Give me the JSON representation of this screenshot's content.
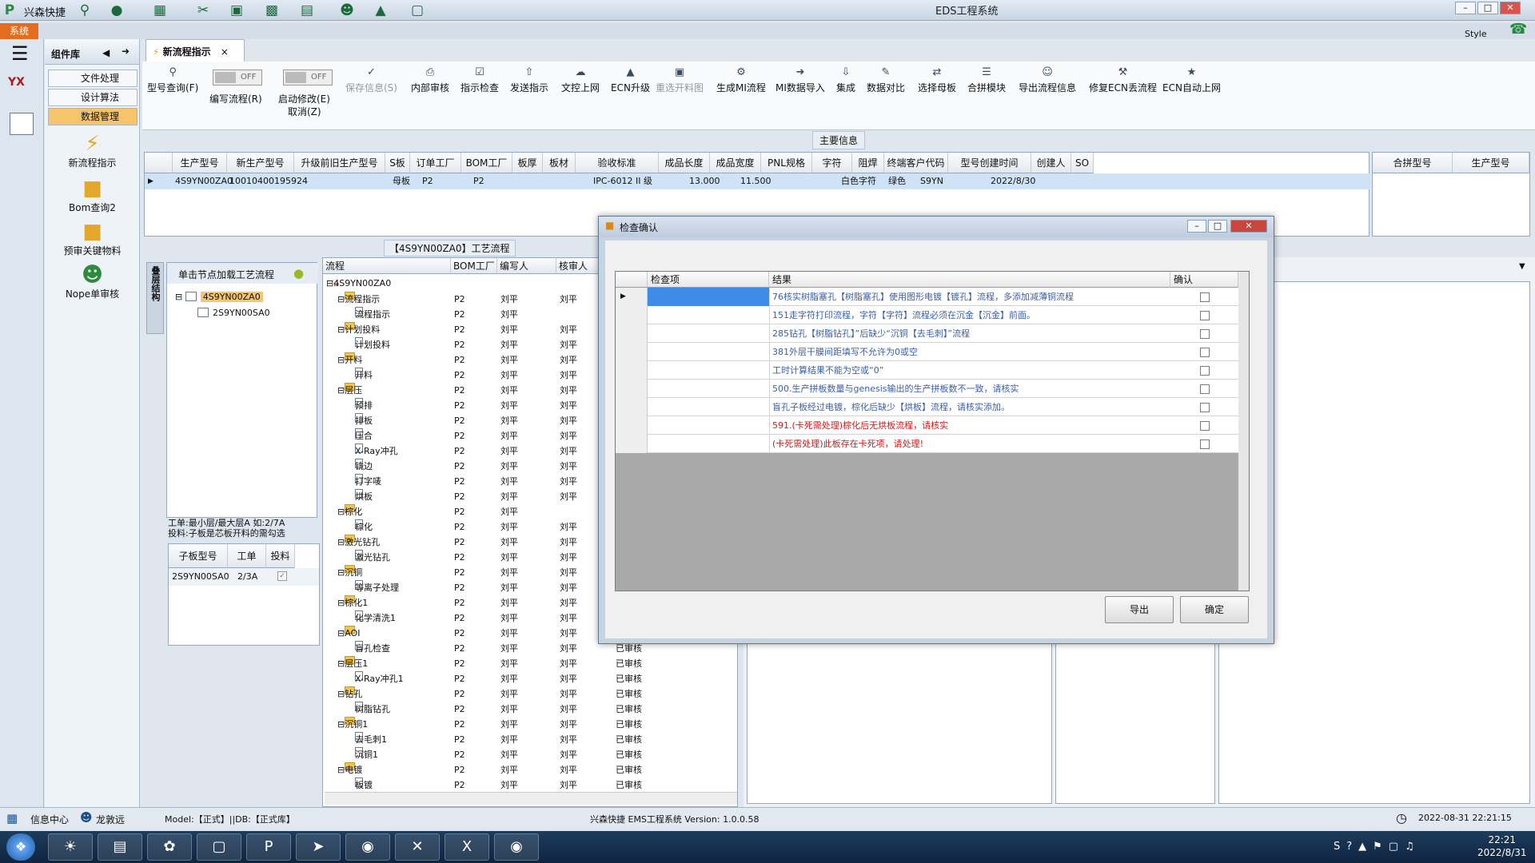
{
  "app": {
    "name": "兴森快捷",
    "window_title": "EDS工程系统",
    "style_label": "Style",
    "system_tab": "系统"
  },
  "component_panel": {
    "title": "组件库",
    "items": [
      "文件处理",
      "设计算法",
      "数据管理"
    ],
    "tools": [
      "新流程指示",
      "Bom查询2",
      "预审关键物料",
      "Nope单审核"
    ]
  },
  "doc_tab": {
    "label": "新流程指示",
    "close": "×"
  },
  "ribbon": {
    "type_query": "型号查询(F)",
    "write_flow": "编写流程(R)",
    "start_modify": "启动修改(E)",
    "cancel": "取消(Z)",
    "toggle_off": "OFF",
    "buttons": [
      "保存信息(S)",
      "内部审核",
      "指示检查",
      "发送指示",
      "文控上网",
      "ECN升级",
      "重选开料图",
      "生成MI流程",
      "MI数据导入",
      "集成",
      "数据对比",
      "选择母板",
      "合拼模块",
      "导出流程信息",
      "修复ECN丢流程",
      "ECN自动上网"
    ]
  },
  "main_info": {
    "label": "主要信息",
    "headers": [
      "生产型号",
      "新生产型号",
      "升级前旧生产型号",
      "S板",
      "订单工厂",
      "BOM工厂",
      "板厚",
      "板材",
      "验收标准",
      "成品长度",
      "成品宽度",
      "PNL规格",
      "字符",
      "阻焊",
      "终端客户代码",
      "型号创建时间",
      "创建人",
      "SO"
    ],
    "row": {
      "c0": "4S9YN00ZA0",
      "c1": "10010400195924",
      "c2": "",
      "c3": "母板",
      "c4": "P2",
      "c5": "P2",
      "c6": "",
      "c7": "",
      "c8": "IPC-6012 II 级",
      "c9": "13.000",
      "c10": "11.500",
      "c11": "",
      "c12": "白色字符",
      "c13": "绿色",
      "c14": "S9YN",
      "c15": "2022/8/30",
      "c16": "",
      "c17": ""
    },
    "merge_headers": [
      "合拼型号",
      "生产型号"
    ]
  },
  "process": {
    "title": "【4S9YN00ZA0】工艺流程",
    "side_tab": "叠层结构",
    "load_hint": "单击节点加载工艺流程",
    "tree_nodes": [
      "4S9YN00ZA0",
      "2S9YN00SA0"
    ],
    "note": "工单:最小层/最大层A 如:2/7A\n投料:子板是芯板开料的需勾选",
    "sub_headers": [
      "子板型号",
      "工单",
      "投料"
    ],
    "sub_row": {
      "model": "2S9YN00SA0",
      "order": "2/3A"
    },
    "tree_headers": [
      "流程",
      "BOM工厂",
      "编写人",
      "核审人"
    ],
    "root": "4S9YN00ZA0",
    "rows": [
      {
        "name": "流程指示",
        "type": "folder",
        "bom": "P2",
        "writer": "刘平",
        "reviewer": "刘平",
        "status": ""
      },
      {
        "name": "流程指示",
        "type": "file",
        "bom": "P2",
        "writer": "刘平",
        "reviewer": "",
        "status": ""
      },
      {
        "name": "计划投料",
        "type": "folder",
        "bom": "P2",
        "writer": "刘平",
        "reviewer": "刘平",
        "status": ""
      },
      {
        "name": "计划投料",
        "type": "file",
        "bom": "P2",
        "writer": "刘平",
        "reviewer": "刘平",
        "status": ""
      },
      {
        "name": "开料",
        "type": "folder",
        "bom": "P2",
        "writer": "刘平",
        "reviewer": "刘平",
        "status": ""
      },
      {
        "name": "开料",
        "type": "file",
        "bom": "P2",
        "writer": "刘平",
        "reviewer": "刘平",
        "status": ""
      },
      {
        "name": "层压",
        "type": "folder",
        "bom": "P2",
        "writer": "刘平",
        "reviewer": "刘平",
        "status": ""
      },
      {
        "name": "预排",
        "type": "file",
        "bom": "P2",
        "writer": "刘平",
        "reviewer": "刘平",
        "status": ""
      },
      {
        "name": "排板",
        "type": "file",
        "bom": "P2",
        "writer": "刘平",
        "reviewer": "刘平",
        "status": ""
      },
      {
        "name": "压合",
        "type": "file",
        "bom": "P2",
        "writer": "刘平",
        "reviewer": "刘平",
        "status": ""
      },
      {
        "name": "X-Ray冲孔",
        "type": "file",
        "bom": "P2",
        "writer": "刘平",
        "reviewer": "刘平",
        "status": ""
      },
      {
        "name": "铣边",
        "type": "file",
        "bom": "P2",
        "writer": "刘平",
        "reviewer": "刘平",
        "status": ""
      },
      {
        "name": "打字唛",
        "type": "file",
        "bom": "P2",
        "writer": "刘平",
        "reviewer": "刘平",
        "status": ""
      },
      {
        "name": "烘板",
        "type": "file",
        "bom": "P2",
        "writer": "刘平",
        "reviewer": "刘平",
        "status": ""
      },
      {
        "name": "棕化",
        "type": "folder",
        "bom": "P2",
        "writer": "刘平",
        "reviewer": "",
        "status": ""
      },
      {
        "name": "棕化",
        "type": "file",
        "bom": "P2",
        "writer": "刘平",
        "reviewer": "刘平",
        "status": ""
      },
      {
        "name": "激光钻孔",
        "type": "folder",
        "bom": "P2",
        "writer": "刘平",
        "reviewer": "刘平",
        "status": ""
      },
      {
        "name": "激光钻孔",
        "type": "file",
        "bom": "P2",
        "writer": "刘平",
        "reviewer": "刘平",
        "status": ""
      },
      {
        "name": "沉铜",
        "type": "folder",
        "bom": "P2",
        "writer": "刘平",
        "reviewer": "刘平",
        "status": ""
      },
      {
        "name": "等离子处理",
        "type": "file",
        "bom": "P2",
        "writer": "刘平",
        "reviewer": "刘平",
        "status": ""
      },
      {
        "name": "棕化1",
        "type": "folder",
        "bom": "P2",
        "writer": "刘平",
        "reviewer": "刘平",
        "status": ""
      },
      {
        "name": "化学清洗1",
        "type": "file",
        "bom": "P2",
        "writer": "刘平",
        "reviewer": "刘平",
        "status": ""
      },
      {
        "name": "AOI",
        "type": "folder",
        "bom": "P2",
        "writer": "刘平",
        "reviewer": "刘平",
        "status": ""
      },
      {
        "name": "盲孔检查",
        "type": "file",
        "bom": "P2",
        "writer": "刘平",
        "reviewer": "刘平",
        "status": "已审核"
      },
      {
        "name": "层压1",
        "type": "folder",
        "bom": "P2",
        "writer": "刘平",
        "reviewer": "刘平",
        "status": "已审核"
      },
      {
        "name": "X-Ray冲孔1",
        "type": "file",
        "bom": "P2",
        "writer": "刘平",
        "reviewer": "刘平",
        "status": "已审核"
      },
      {
        "name": "钻孔",
        "type": "folder",
        "bom": "P2",
        "writer": "刘平",
        "reviewer": "刘平",
        "status": "已审核"
      },
      {
        "name": "树脂钻孔",
        "type": "file",
        "bom": "P2",
        "writer": "刘平",
        "reviewer": "刘平",
        "status": "已审核"
      },
      {
        "name": "沉铜1",
        "type": "folder",
        "bom": "P2",
        "writer": "刘平",
        "reviewer": "刘平",
        "status": "已审核"
      },
      {
        "name": "去毛刺1",
        "type": "file",
        "bom": "P2",
        "writer": "刘平",
        "reviewer": "刘平",
        "status": "已审核"
      },
      {
        "name": "沉铜1",
        "type": "file",
        "bom": "P2",
        "writer": "刘平",
        "reviewer": "刘平",
        "status": "已审核"
      },
      {
        "name": "电镀",
        "type": "folder",
        "bom": "P2",
        "writer": "刘平",
        "reviewer": "刘平",
        "status": "已审核"
      },
      {
        "name": "板镀",
        "type": "file",
        "bom": "P2",
        "writer": "刘平",
        "reviewer": "刘平",
        "status": "已审核"
      }
    ]
  },
  "dialog": {
    "title": "检查确认",
    "headers": [
      "检查项",
      "结果",
      "确认"
    ],
    "rows": [
      {
        "item": "",
        "result": "76核实树脂塞孔【树脂塞孔】使用图形电镀【镀孔】流程，多添加减薄铜流程",
        "color": "#3a5fa8"
      },
      {
        "item": "",
        "result": "151走字符打印流程，字符【字符】流程必须在沉金【沉金】前面。",
        "color": "#3a5fa8"
      },
      {
        "item": "",
        "result": "285钻孔【树脂钻孔】”后缺少“沉铜【去毛刺】”流程",
        "color": "#3a5fa8"
      },
      {
        "item": "",
        "result": "381外层干膜间距填写不允许为0或空",
        "color": "#3a5fa8"
      },
      {
        "item": "",
        "result": "工时计算结果不能为空或“0”",
        "color": "#3a5fa8"
      },
      {
        "item": "",
        "result": "500.生产拼板数量与genesis输出的生产拼板数不一致，请核实",
        "color": "#3a5fa8"
      },
      {
        "item": "",
        "result": "盲孔子板经过电镀，棕化后缺少【烘板】流程，请核实添加。",
        "color": "#3a5fa8"
      },
      {
        "item": "",
        "result": "591.(卡死需处理)棕化后无烘板流程，请核实",
        "color": "#d11a1a"
      },
      {
        "item": "",
        "result": "(卡死需处理)此板存在卡死项，请处理!",
        "color": "#d11a1a"
      }
    ],
    "export_button": "导出",
    "ok_button": "确定"
  },
  "status_bar": {
    "info_center": "信息中心",
    "user": "龙敦远",
    "model": "Model:【正式】||DB:【正式库】",
    "version": "兴森快捷 EMS工程系统 Version: 1.0.0.58",
    "datetime": "2022-08-31 22:21:15"
  },
  "taskbar": {
    "time": "22:21",
    "date": "2022/8/31"
  }
}
